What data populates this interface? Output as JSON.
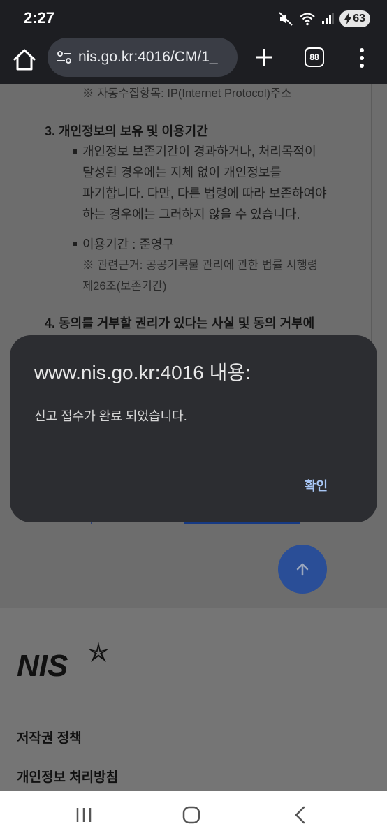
{
  "status": {
    "time": "2:27",
    "battery": "63"
  },
  "browser": {
    "url": "nis.go.kr:4016/CM/1_",
    "tab_count": "88"
  },
  "page": {
    "collection_note": "※ 자동수집항목: IP(Internet Protocol)주소",
    "section3_heading": "3. 개인정보의 보유 및 이용기간",
    "retention_lines": [
      "개인정보 보존기간이 경과하거나, 처리목적이",
      "달성된 경우에는 지체 없이 개인정보를",
      "파기합니다. 다만, 다른 법령에 따라 보존하여야",
      "하는 경우에는 그러하지 않을 수 있습니다."
    ],
    "period_label": "이용기간 : 준영구",
    "basis_lines": [
      "※ 관련근거: 공공기록물 관리에 관한 법률 시행령",
      "제26조(보존기간)"
    ],
    "section4_heading": "4. 동의를 거부할 권리가 있다는 사실 및 동의 거부에"
  },
  "footer": {
    "logo_text": "NIS",
    "links": [
      "저작권 정책",
      "개인정보 처리방침"
    ]
  },
  "dialog": {
    "title": "www.nis.go.kr:4016 내용:",
    "message": "신고 접수가 완료 되었습니다.",
    "ok_label": "확인"
  }
}
